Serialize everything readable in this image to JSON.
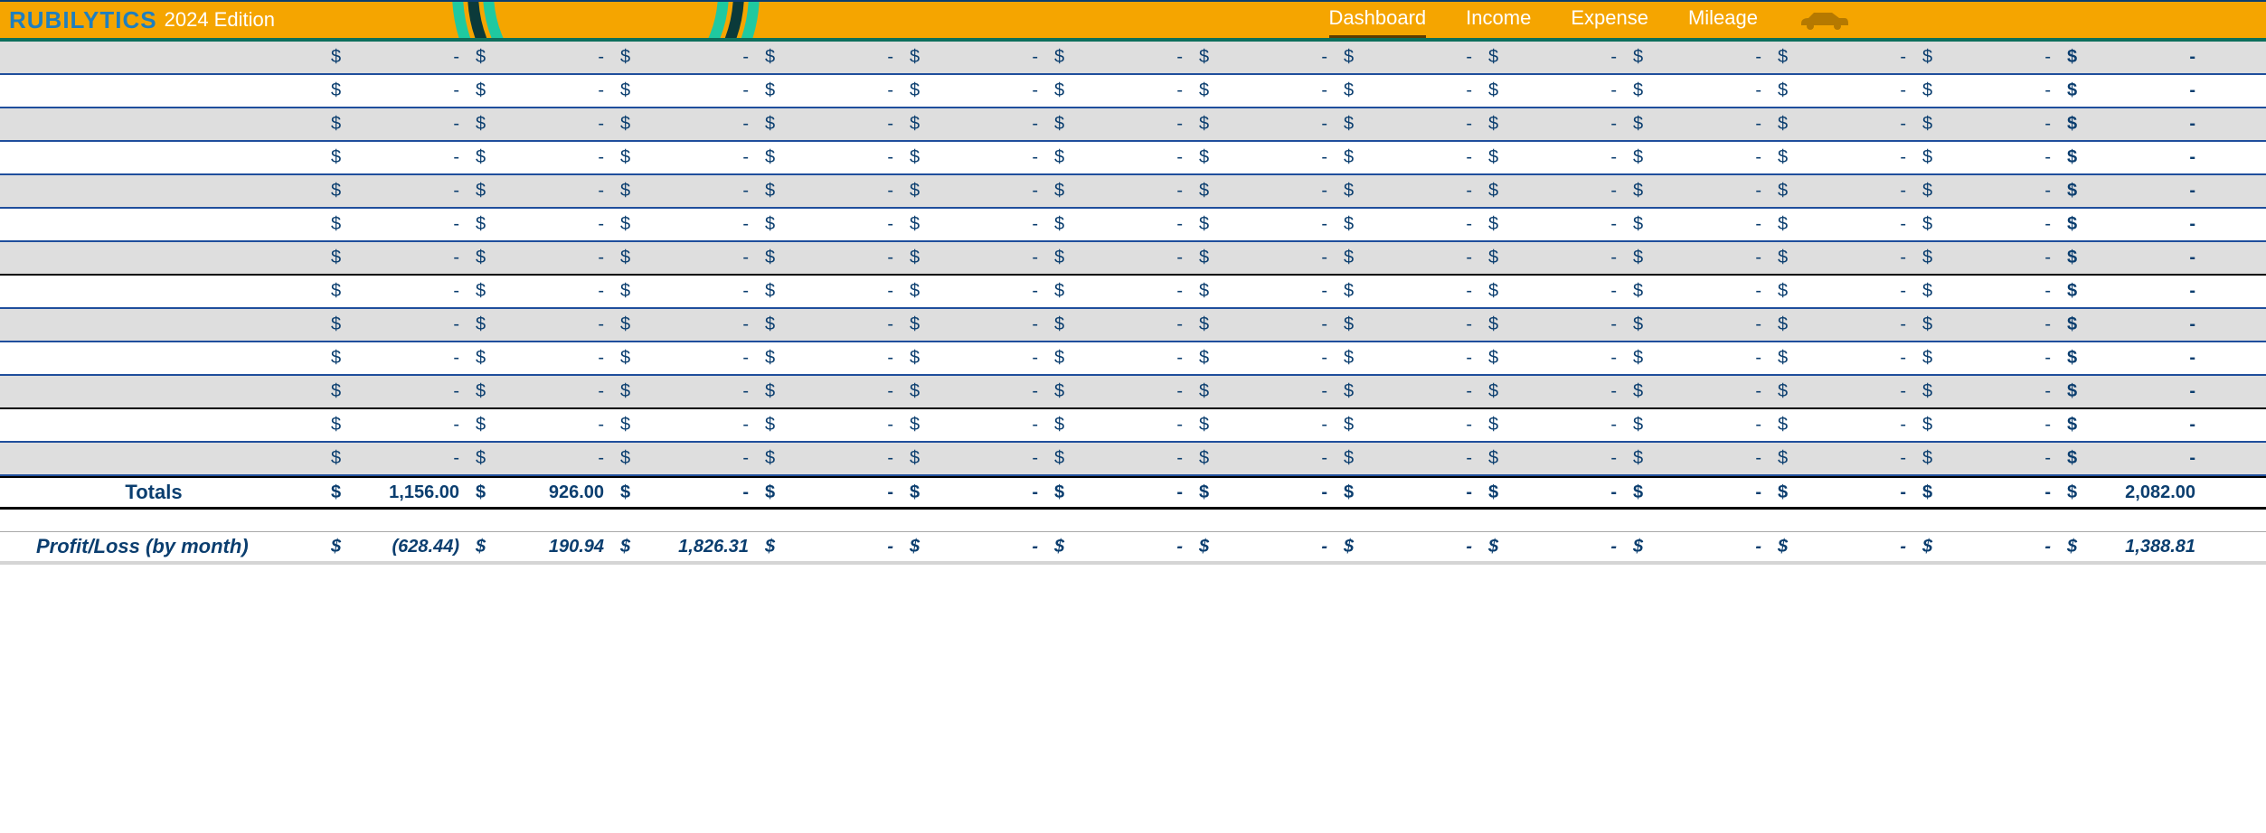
{
  "brand": "RUBILYTICS",
  "edition": "2024 Edition",
  "nav": {
    "dashboard": "Dashboard",
    "income": "Income",
    "expense": "Expense",
    "mileage": "Mileage"
  },
  "columns": 13,
  "currency_symbol": "$",
  "dash": "-",
  "data_rows": [
    {
      "alt": true,
      "values": [
        "-",
        "-",
        "-",
        "-",
        "-",
        "-",
        "-",
        "-",
        "-",
        "-",
        "-",
        "-",
        "-"
      ]
    },
    {
      "alt": false,
      "values": [
        "-",
        "-",
        "-",
        "-",
        "-",
        "-",
        "-",
        "-",
        "-",
        "-",
        "-",
        "-",
        "-"
      ]
    },
    {
      "alt": true,
      "values": [
        "-",
        "-",
        "-",
        "-",
        "-",
        "-",
        "-",
        "-",
        "-",
        "-",
        "-",
        "-",
        "-"
      ]
    },
    {
      "alt": false,
      "values": [
        "-",
        "-",
        "-",
        "-",
        "-",
        "-",
        "-",
        "-",
        "-",
        "-",
        "-",
        "-",
        "-"
      ]
    },
    {
      "alt": true,
      "values": [
        "-",
        "-",
        "-",
        "-",
        "-",
        "-",
        "-",
        "-",
        "-",
        "-",
        "-",
        "-",
        "-"
      ]
    },
    {
      "alt": false,
      "values": [
        "-",
        "-",
        "-",
        "-",
        "-",
        "-",
        "-",
        "-",
        "-",
        "-",
        "-",
        "-",
        "-"
      ]
    },
    {
      "alt": true,
      "thick": true,
      "values": [
        "-",
        "-",
        "-",
        "-",
        "-",
        "-",
        "-",
        "-",
        "-",
        "-",
        "-",
        "-",
        "-"
      ]
    },
    {
      "alt": false,
      "values": [
        "-",
        "-",
        "-",
        "-",
        "-",
        "-",
        "-",
        "-",
        "-",
        "-",
        "-",
        "-",
        "-"
      ]
    },
    {
      "alt": true,
      "values": [
        "-",
        "-",
        "-",
        "-",
        "-",
        "-",
        "-",
        "-",
        "-",
        "-",
        "-",
        "-",
        "-"
      ]
    },
    {
      "alt": false,
      "values": [
        "-",
        "-",
        "-",
        "-",
        "-",
        "-",
        "-",
        "-",
        "-",
        "-",
        "-",
        "-",
        "-"
      ]
    },
    {
      "alt": true,
      "thick": true,
      "values": [
        "-",
        "-",
        "-",
        "-",
        "-",
        "-",
        "-",
        "-",
        "-",
        "-",
        "-",
        "-",
        "-"
      ]
    },
    {
      "alt": false,
      "values": [
        "-",
        "-",
        "-",
        "-",
        "-",
        "-",
        "-",
        "-",
        "-",
        "-",
        "-",
        "-",
        "-"
      ]
    },
    {
      "alt": true,
      "values": [
        "-",
        "-",
        "-",
        "-",
        "-",
        "-",
        "-",
        "-",
        "-",
        "-",
        "-",
        "-",
        "-"
      ]
    }
  ],
  "totals": {
    "label": "Totals",
    "values": [
      "1,156.00",
      "926.00",
      "-",
      "-",
      "-",
      "-",
      "-",
      "-",
      "-",
      "-",
      "-",
      "-",
      "2,082.00"
    ]
  },
  "profit_loss": {
    "label": "Profit/Loss (by month)",
    "values": [
      "(628.44)",
      "190.94",
      "1,826.31",
      "-",
      "-",
      "-",
      "-",
      "-",
      "-",
      "-",
      "-",
      "-",
      "1,388.81"
    ]
  }
}
